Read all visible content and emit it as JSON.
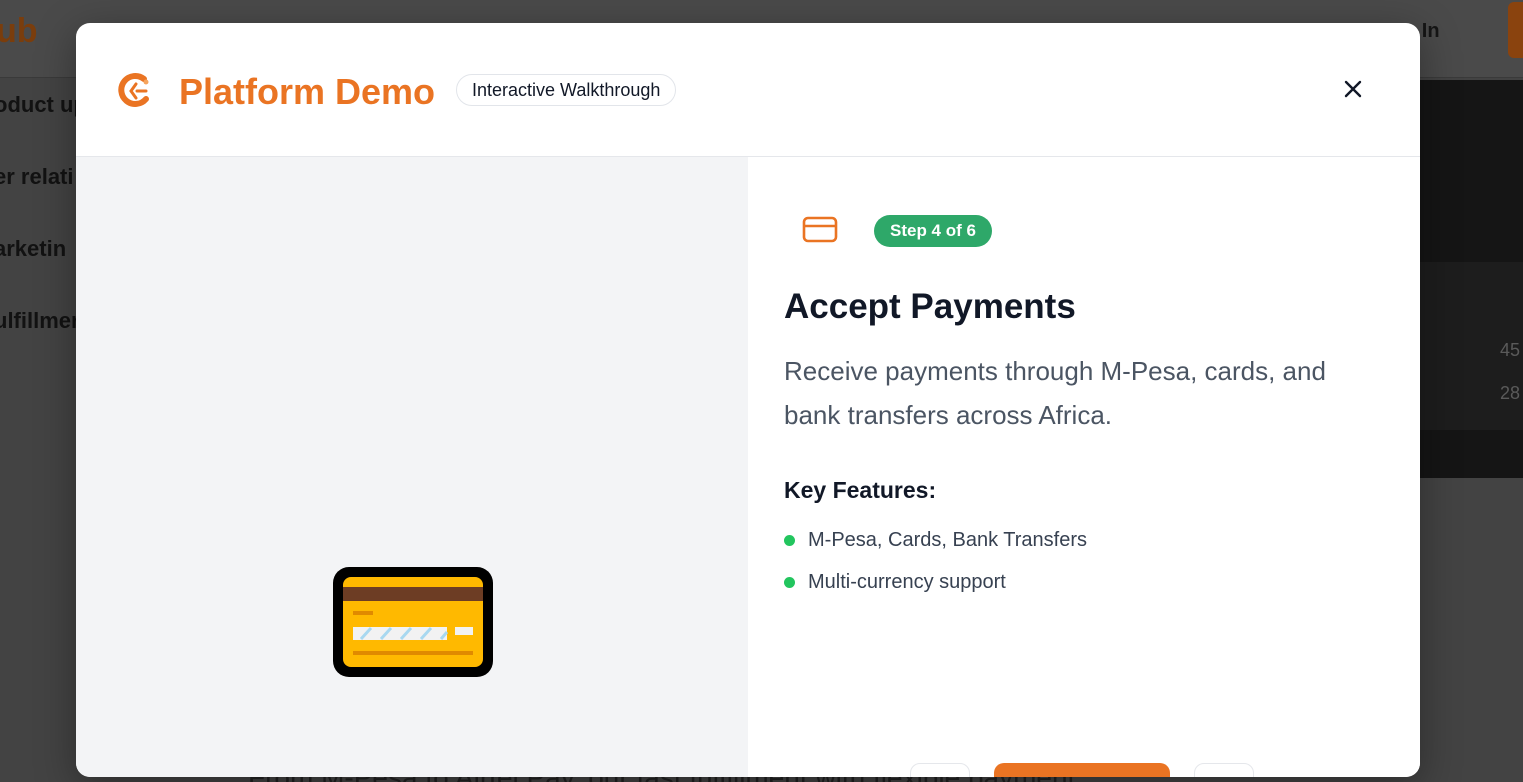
{
  "background": {
    "logo_fragment": "ub",
    "signin_label": "n In",
    "sidebar_items": [
      "oduct up",
      "er relati",
      "arketin",
      "ulfillmer"
    ],
    "numbers": [
      "45",
      "28"
    ],
    "bottom_text": "From M-Pesa to Airtel Pay, our fast fulfillment with flexible payment"
  },
  "modal": {
    "title": "Platform Demo",
    "badge": "Interactive Walkthrough",
    "close_icon": "close-icon",
    "illustration": "credit-card-illustration",
    "step": {
      "icon": "credit-card-icon",
      "label": "Step 4 of 6",
      "title": "Accept Payments",
      "description": "Receive payments through M-Pesa, cards, and bank transfers across Africa.",
      "features_heading": "Key Features:",
      "features": [
        "M-Pesa, Cards, Bank Transfers",
        "Multi-currency support"
      ]
    },
    "colors": {
      "accent": "#ea7423",
      "step_badge": "#2ea869",
      "feature_dot": "#22c55e"
    }
  }
}
